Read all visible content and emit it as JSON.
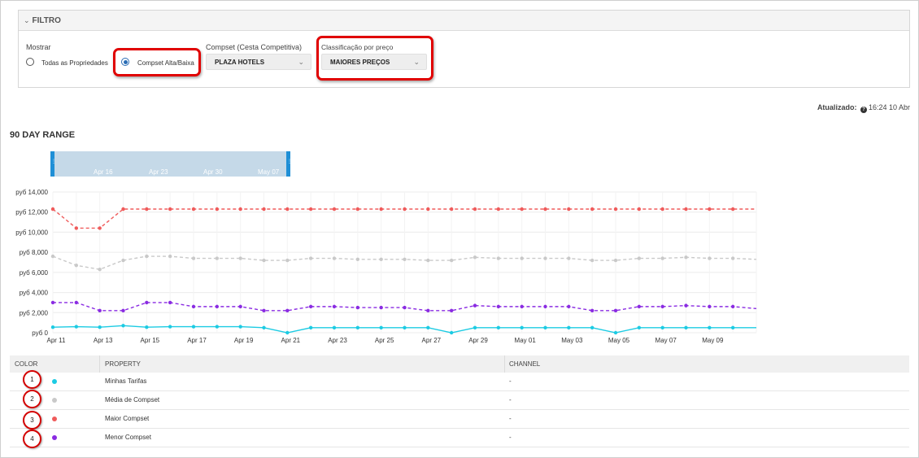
{
  "filter": {
    "header": "FILTRO",
    "show_label": "Mostrar",
    "radio_all": "Todas as Propriedades",
    "radio_compset": "Compset Alta/Baixa",
    "compset_label": "Compset (Cesta Competitiva)",
    "compset_value": "PLAZA HOTELS",
    "price_label": "Classificação por preço",
    "price_value": "MAIORES PREÇOS"
  },
  "updated": {
    "label": "Atualizado:",
    "value": "16:24 10 Abr"
  },
  "section_title": "90 DAY RANGE",
  "range_labels": [
    "Apr 16",
    "Apr 23",
    "Apr 30",
    "May 07"
  ],
  "colors": {
    "mine": "#1ccbe3",
    "avg": "#c9c9c9",
    "max": "#ef5b5b",
    "min": "#8a2be2",
    "accent": "#1f8fd6"
  },
  "chart_data": {
    "type": "line",
    "y_ticks": [
      "руб 0",
      "руб 2,000",
      "руб 4,000",
      "руб 6,000",
      "руб 8,000",
      "руб 10,000",
      "руб 12,000",
      "руб 14,000"
    ],
    "ylim": [
      0,
      14000
    ],
    "x_tick_labels": [
      "Apr 11",
      "Apr 13",
      "Apr 15",
      "Apr 17",
      "Apr 19",
      "Apr 21",
      "Apr 23",
      "Apr 25",
      "Apr 27",
      "Apr 29",
      "May 01",
      "May 03",
      "May 05",
      "May 07",
      "May 09"
    ],
    "x": [
      "Apr 11",
      "Apr 12",
      "Apr 13",
      "Apr 14",
      "Apr 15",
      "Apr 16",
      "Apr 17",
      "Apr 18",
      "Apr 19",
      "Apr 20",
      "Apr 21",
      "Apr 22",
      "Apr 23",
      "Apr 24",
      "Apr 25",
      "Apr 26",
      "Apr 27",
      "Apr 28",
      "Apr 29",
      "Apr 30",
      "May 01",
      "May 02",
      "May 03",
      "May 04",
      "May 05",
      "May 06",
      "May 07",
      "May 08",
      "May 09",
      "May 10",
      "May 11"
    ],
    "grid": true,
    "series": [
      {
        "name": "Maior Compset",
        "color": "#ef5b5b",
        "dashed": true,
        "values": [
          12300,
          10400,
          10400,
          12300,
          12300,
          12300,
          12300,
          12300,
          12300,
          12300,
          12300,
          12300,
          12300,
          12300,
          12300,
          12300,
          12300,
          12300,
          12300,
          12300,
          12300,
          12300,
          12300,
          12300,
          12300,
          12300,
          12300,
          12300,
          12300,
          12300,
          12300
        ]
      },
      {
        "name": "Média de Compset",
        "color": "#c9c9c9",
        "dashed": true,
        "values": [
          7600,
          6700,
          6300,
          7200,
          7600,
          7600,
          7400,
          7400,
          7400,
          7200,
          7200,
          7400,
          7400,
          7300,
          7300,
          7300,
          7200,
          7200,
          7500,
          7400,
          7400,
          7400,
          7400,
          7200,
          7200,
          7400,
          7400,
          7500,
          7400,
          7400,
          7300
        ]
      },
      {
        "name": "Menor Compset",
        "color": "#8a2be2",
        "dashed": true,
        "values": [
          3000,
          3000,
          2200,
          2200,
          3000,
          3000,
          2600,
          2600,
          2600,
          2200,
          2200,
          2600,
          2600,
          2500,
          2500,
          2500,
          2200,
          2200,
          2700,
          2600,
          2600,
          2600,
          2600,
          2200,
          2200,
          2600,
          2600,
          2700,
          2600,
          2600,
          2400
        ]
      },
      {
        "name": "Minhas Tarifas",
        "color": "#1ccbe3",
        "dashed": false,
        "values": [
          550,
          600,
          550,
          700,
          550,
          600,
          600,
          600,
          600,
          500,
          0,
          500,
          500,
          500,
          500,
          500,
          500,
          0,
          500,
          500,
          500,
          500,
          500,
          500,
          0,
          500,
          500,
          500,
          500,
          500,
          500
        ]
      }
    ]
  },
  "table": {
    "headers": [
      "COLOR",
      "PROPERTY",
      "CHANNEL"
    ],
    "rows": [
      {
        "num": "1",
        "color": "#1ccbe3",
        "property": "Minhas Tarifas",
        "channel": "-"
      },
      {
        "num": "2",
        "color": "#c9c9c9",
        "property": "Média de Compset",
        "channel": "-"
      },
      {
        "num": "3",
        "color": "#ef5b5b",
        "property": "Maior Compset",
        "channel": "-"
      },
      {
        "num": "4",
        "color": "#8a2be2",
        "property": "Menor Compset",
        "channel": "-"
      }
    ]
  }
}
